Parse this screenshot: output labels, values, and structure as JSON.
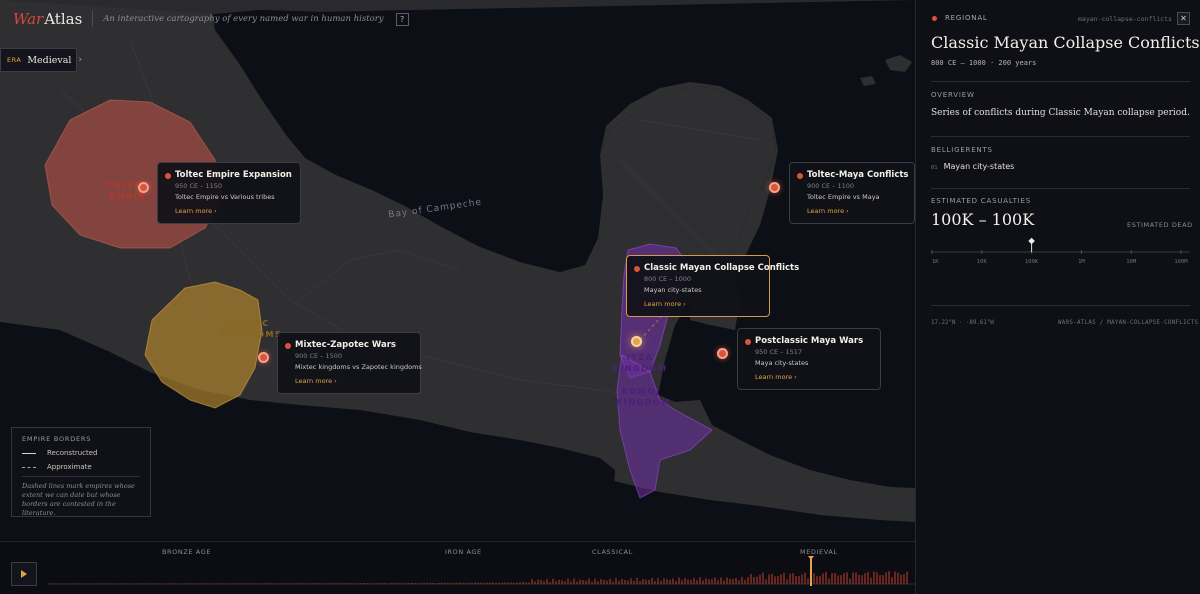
{
  "header": {
    "brand_italic": "War",
    "brand_rest": "Atlas",
    "tagline": "An interactive cartography of every named war in human history",
    "help_label": "?"
  },
  "era": {
    "key": "ERA",
    "value": "Medieval",
    "chevron": "›"
  },
  "map": {
    "sea_label": "Bay of Campeche",
    "regions": [
      {
        "label": "TOLTEC EMPIR",
        "color": "#d7564a"
      },
      {
        "label": "MIXTEC KINGDOMS",
        "color": "#d9a23a"
      },
      {
        "label": "ITZA KINGDOM",
        "color": "#8a3fc4"
      },
      {
        "label": "KOWOJ KINGDOM",
        "color": "#8a3fc4"
      }
    ],
    "conflicts": [
      {
        "title": "Toltec Empire Expansion",
        "dates": "950 CE – 1150",
        "belligerents": "Toltec Empire vs Various tribes",
        "link": "Learn more ›"
      },
      {
        "title": "Mixtec-Zapotec Wars",
        "dates": "900 CE – 1500",
        "belligerents": "Mixtec kingdoms vs Zapotec kingdoms",
        "link": "Learn more ›"
      },
      {
        "title": "Classic Mayan Collapse Conflicts",
        "dates": "800 CE – 1000",
        "belligerents": "Mayan city-states",
        "link": "Learn more ›"
      },
      {
        "title": "Toltec-Maya Conflicts",
        "dates": "900 CE – 1100",
        "belligerents": "Toltec Empire vs Maya",
        "link": "Learn more ›"
      },
      {
        "title": "Postclassic Maya Wars",
        "dates": "950 CE – 1517",
        "belligerents": "Maya city-states",
        "link": "Learn more ›"
      }
    ]
  },
  "legend": {
    "title": "EMPIRE BORDERS",
    "solid": "Reconstructed",
    "dashed": "Approximate",
    "note": "Dashed lines mark empires whose extent we can date but whose borders are contested in the literature."
  },
  "timeline": {
    "eras": [
      "BRONZE AGE",
      "IRON AGE",
      "CLASSICAL",
      "MEDIEVAL"
    ],
    "current_era": "MEDIEVAL"
  },
  "panel": {
    "category": "REGIONAL",
    "slug": "mayan-collapse-conflicts",
    "close_label": "✕",
    "title": "Classic Mayan Collapse Conflicts",
    "dates": "800 CE — 1000  ·  200 years",
    "overview_heading": "OVERVIEW",
    "overview": "Series of conflicts during Classic Mayan collapse period.",
    "belligerents_heading": "BELLIGERENTS",
    "belligerents": [
      {
        "index": "01",
        "name": "Mayan city-states"
      }
    ],
    "casualties_heading": "ESTIMATED CASUALTIES",
    "casualties": "100K – 100K",
    "casualties_caption": "ESTIMATED DEAD",
    "scale_ticks": [
      "1K",
      "10K",
      "100K",
      "1M",
      "10M",
      "100M"
    ],
    "casualty_value": 100000,
    "coords": "17.22°N · -89.61°W",
    "credit": "WARS-ATLAS / MAYAN-COLLAPSE-CONFLICTS"
  }
}
